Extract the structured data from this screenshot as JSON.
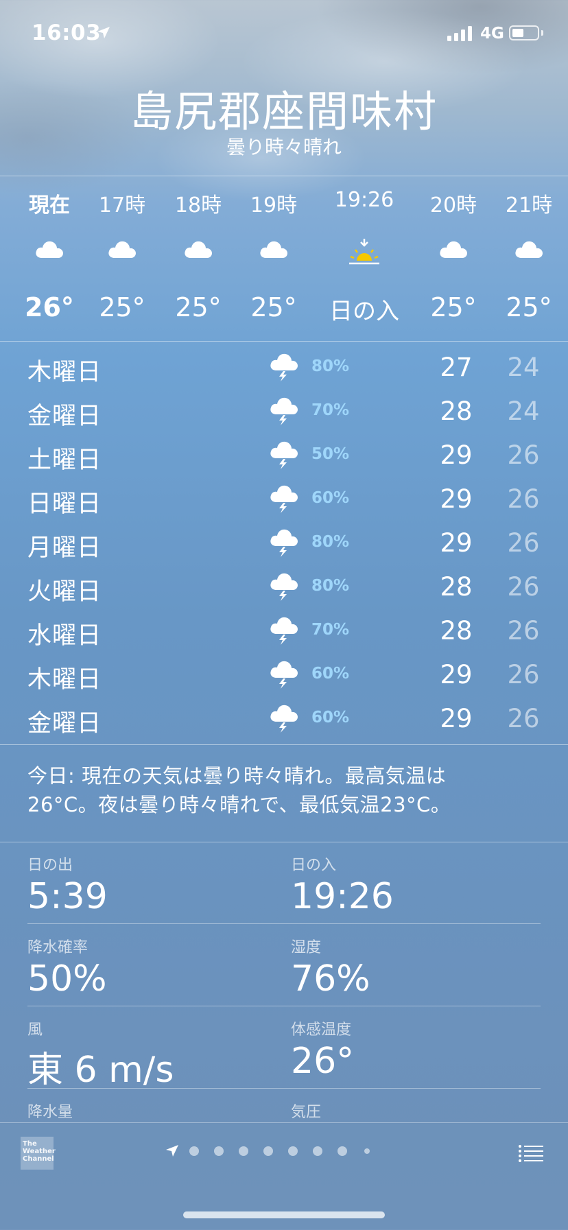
{
  "status": {
    "time": "16:03",
    "network": "4G"
  },
  "header": {
    "city": "島尻郡座間味村",
    "condition": "曇り時々晴れ"
  },
  "hourly": [
    {
      "label": "現在",
      "icon": "cloud-icon",
      "temp": "26°",
      "bold": true
    },
    {
      "label": "17時",
      "icon": "cloud-icon",
      "temp": "25°"
    },
    {
      "label": "18時",
      "icon": "cloud-icon",
      "temp": "25°"
    },
    {
      "label": "19時",
      "icon": "cloud-icon",
      "temp": "25°"
    },
    {
      "label": "19:26",
      "icon": "sunset-icon",
      "temp": "日の入"
    },
    {
      "label": "20時",
      "icon": "cloud-icon",
      "temp": "25°"
    },
    {
      "label": "21時",
      "icon": "cloud-icon",
      "temp": "25°"
    }
  ],
  "daily": [
    {
      "day": "木曜日",
      "icon": "thunderstorm-icon",
      "precip": "80%",
      "high": "27",
      "low": "24"
    },
    {
      "day": "金曜日",
      "icon": "thunderstorm-icon",
      "precip": "70%",
      "high": "28",
      "low": "24"
    },
    {
      "day": "土曜日",
      "icon": "thunderstorm-icon",
      "precip": "50%",
      "high": "29",
      "low": "26"
    },
    {
      "day": "日曜日",
      "icon": "thunderstorm-icon",
      "precip": "60%",
      "high": "29",
      "low": "26"
    },
    {
      "day": "月曜日",
      "icon": "thunderstorm-icon",
      "precip": "80%",
      "high": "29",
      "low": "26"
    },
    {
      "day": "火曜日",
      "icon": "thunderstorm-icon",
      "precip": "80%",
      "high": "28",
      "low": "26"
    },
    {
      "day": "水曜日",
      "icon": "thunderstorm-icon",
      "precip": "70%",
      "high": "28",
      "low": "26"
    },
    {
      "day": "木曜日",
      "icon": "thunderstorm-icon",
      "precip": "60%",
      "high": "29",
      "low": "26"
    },
    {
      "day": "金曜日",
      "icon": "thunderstorm-icon",
      "precip": "60%",
      "high": "29",
      "low": "26"
    }
  ],
  "summary": {
    "line1": "今日: 現在の天気は曇り時々晴れ。最高気温は",
    "line2": "26°C。夜は曇り時々晴れで、最低気温23°C。"
  },
  "details": {
    "sunrise": {
      "label": "日の出",
      "value": "5:39"
    },
    "sunset": {
      "label": "日の入",
      "value": "19:26"
    },
    "precip_chance": {
      "label": "降水確率",
      "value": "50%"
    },
    "humidity": {
      "label": "湿度",
      "value": "76%"
    },
    "wind": {
      "label": "風",
      "value": "東 6 m/s"
    },
    "feels_like": {
      "label": "体感温度",
      "value": "26°"
    },
    "precip_amount": {
      "label": "降水量"
    },
    "pressure": {
      "label": "気圧"
    }
  },
  "footer": {
    "logo_lines": [
      "The",
      "Weather",
      "Channel"
    ],
    "page_count": 9,
    "active_page": 0
  },
  "colors": {
    "precip": "#9fd6fa",
    "sun": "#f7c800"
  }
}
